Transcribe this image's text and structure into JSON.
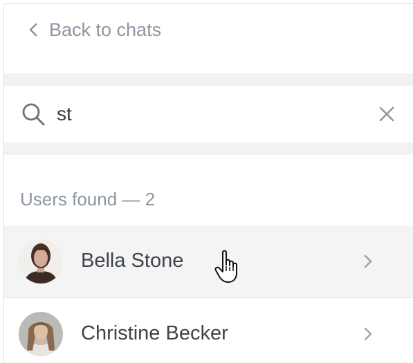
{
  "nav": {
    "back_label": "Back to chats",
    "back_icon": "chevron-left-icon"
  },
  "search": {
    "value": "st",
    "placeholder": "",
    "search_icon": "search-icon",
    "clear_icon": "close-icon"
  },
  "results": {
    "title": "Users found — 2",
    "users": [
      {
        "name": "Bella Stone",
        "hovered": true
      },
      {
        "name": "Christine Becker",
        "hovered": false
      }
    ],
    "row_arrow_icon": "chevron-right-icon"
  },
  "colors": {
    "muted_text": "#8d96a0",
    "name_text": "#3d444c",
    "hover_row": "#f4f4f4",
    "section_gap": "#f2f2f2"
  }
}
